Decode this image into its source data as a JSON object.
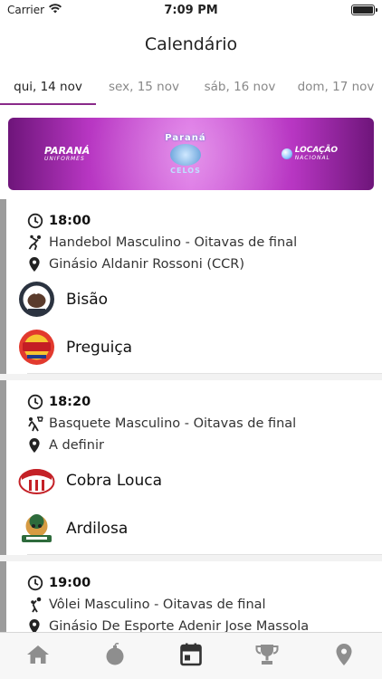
{
  "status_bar": {
    "carrier": "Carrier",
    "time": "7:09 PM"
  },
  "header": {
    "title": "Calendário"
  },
  "date_tabs": [
    {
      "label": "qui, 14 nov",
      "active": true
    },
    {
      "label": "sex, 15 nov",
      "active": false
    },
    {
      "label": "sáb, 16 nov",
      "active": false
    },
    {
      "label": "dom, 17 nov",
      "active": false
    }
  ],
  "banner": {
    "sponsor_left": "PARANÁ",
    "sponsor_left_sub": "UNIFORMES",
    "center_top": "Paraná",
    "center_bottom": "CELOS",
    "sponsor_right": "LOCAÇÃO",
    "sponsor_right_sub": "NACIONAL"
  },
  "games": [
    {
      "time": "18:00",
      "sport": "Handebol Masculino - Oitavas de final",
      "sport_icon": "handball-icon",
      "location": "Ginásio Aldanir Rossoni (CCR)",
      "home_team": "Bisão",
      "away_team": "Preguiça"
    },
    {
      "time": "18:20",
      "sport": "Basquete Masculino - Oitavas de final",
      "sport_icon": "basketball-icon",
      "location": "A definir",
      "home_team": "Cobra Louca",
      "away_team": "Ardilosa"
    },
    {
      "time": "19:00",
      "sport": "Vôlei Masculino - Oitavas de final",
      "sport_icon": "volleyball-icon",
      "location": "Ginásio De Esporte Adenir Jose Massola",
      "home_team": "",
      "away_team": ""
    }
  ],
  "tab_bar": {
    "items": [
      "home-icon",
      "bomb-icon",
      "calendar-icon",
      "trophy-icon",
      "location-icon"
    ],
    "active": "calendar-icon"
  },
  "colors": {
    "accent": "#8a2a8a",
    "card_border": "#9c9c9c",
    "tab_active": "#333333",
    "tab_inactive": "#8e8e8e"
  }
}
